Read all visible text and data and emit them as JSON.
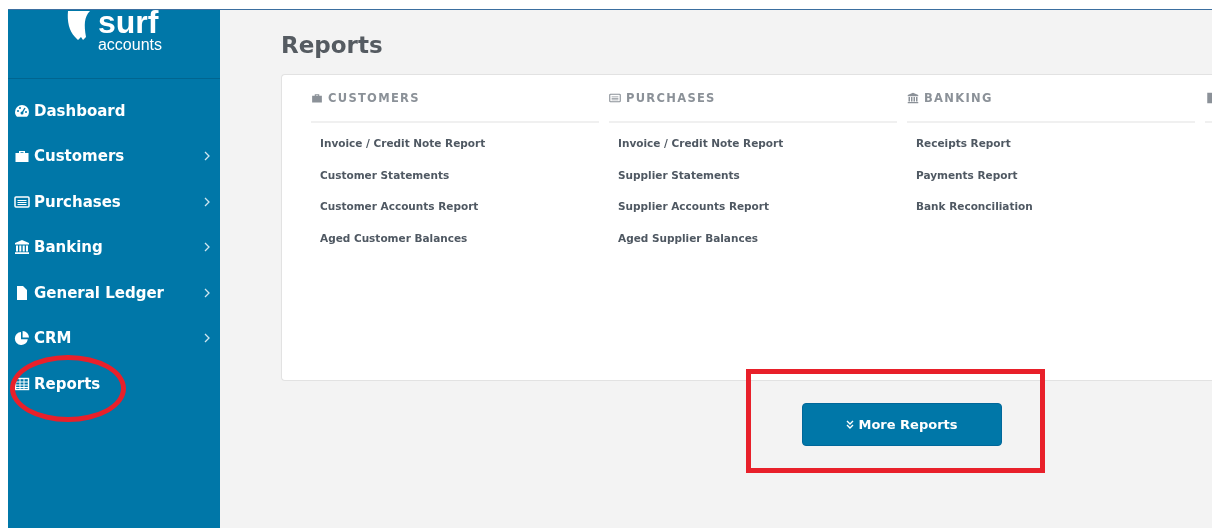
{
  "logo": {
    "name": "surf",
    "tagline": "accounts"
  },
  "sidebar": {
    "items": [
      {
        "label": "Dashboard",
        "expandable": false
      },
      {
        "label": "Customers",
        "expandable": true
      },
      {
        "label": "Purchases",
        "expandable": true
      },
      {
        "label": "Banking",
        "expandable": true
      },
      {
        "label": "General Ledger",
        "expandable": true
      },
      {
        "label": "CRM",
        "expandable": true
      },
      {
        "label": "Reports",
        "expandable": false
      }
    ]
  },
  "page": {
    "title": "Reports"
  },
  "report_groups": [
    {
      "kind": "full",
      "heading": "CUSTOMERS",
      "links": [
        "Invoice / Credit Note Report",
        "Customer Statements",
        "Customer Accounts Report",
        "Aged Customer Balances"
      ]
    },
    {
      "kind": "full",
      "heading": "PURCHASES",
      "links": [
        "Invoice / Credit Note Report",
        "Supplier Statements",
        "Supplier Accounts Report",
        "Aged Supplier Balances"
      ]
    },
    {
      "kind": "full",
      "heading": "BANKING",
      "links": [
        "Receipts Report",
        "Payments Report",
        "Bank Reconciliation"
      ]
    },
    {
      "kind": "cut"
    }
  ],
  "more_button": {
    "label": "More Reports"
  },
  "annotations": [
    {
      "kind": "ellipse"
    },
    {
      "kind": "rectangle"
    }
  ]
}
